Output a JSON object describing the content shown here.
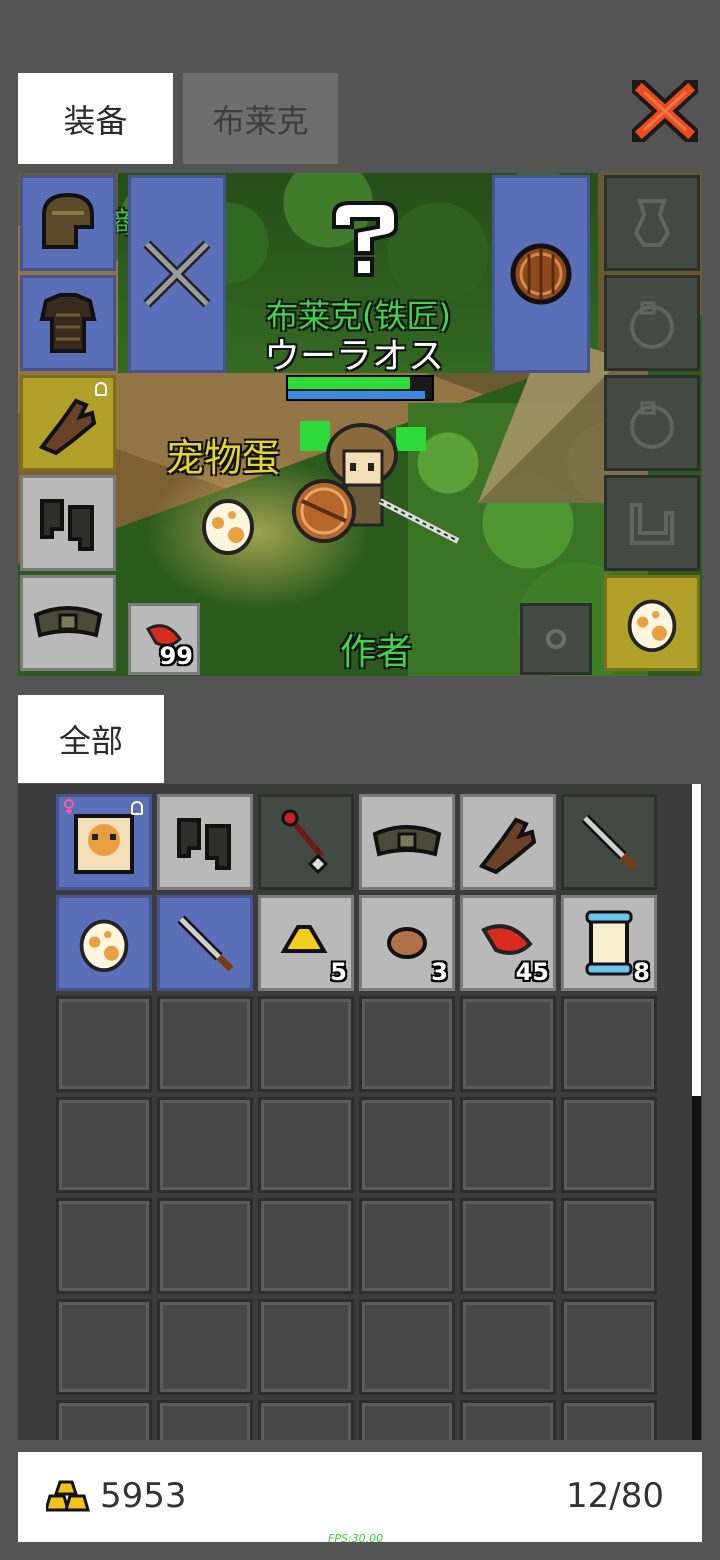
{
  "tabs": {
    "equipment": "装备",
    "character": "布莱克"
  },
  "scene": {
    "npc_name": "布莱克(铁匠)",
    "player_name": "ウーラオス",
    "pet_egg_label": "宠物蛋",
    "author_label": "作者",
    "partial_label": "商",
    "quick_item_count": "99",
    "hp_fraction": 0.85,
    "mp_fraction": 0.95
  },
  "equip_left": [
    {
      "icon": "helmet-icon",
      "style": "blue"
    },
    {
      "icon": "armor-icon",
      "style": "blue"
    },
    {
      "icon": "glove-icon",
      "style": "gold",
      "locked": true
    },
    {
      "icon": "boots-icon",
      "style": "grey"
    },
    {
      "icon": "belt-icon",
      "style": "grey"
    }
  ],
  "equip_right": [
    {
      "icon": "vase-icon",
      "style": "dark"
    },
    {
      "icon": "ring-icon",
      "style": "dark"
    },
    {
      "icon": "ring-icon",
      "style": "dark"
    },
    {
      "icon": "pet-icon",
      "style": "dark"
    },
    {
      "icon": "egg-icon",
      "style": "gold"
    }
  ],
  "inventory_filter": "全部",
  "inventory": [
    {
      "icon": "pet-portrait-icon",
      "style": "blue",
      "locked": true,
      "female": true
    },
    {
      "icon": "boots-icon",
      "style": "grey"
    },
    {
      "icon": "staff-icon",
      "style": "dark"
    },
    {
      "icon": "belt-icon",
      "style": "grey"
    },
    {
      "icon": "glove-icon",
      "style": "grey"
    },
    {
      "icon": "sword-icon",
      "style": "dark"
    },
    {
      "icon": "egg-icon",
      "style": "blue"
    },
    {
      "icon": "sword-icon",
      "style": "blue"
    },
    {
      "icon": "gold-ore-icon",
      "style": "grey",
      "count": "5"
    },
    {
      "icon": "stone-icon",
      "style": "grey",
      "count": "3"
    },
    {
      "icon": "red-feather-icon",
      "style": "grey",
      "count": "45"
    },
    {
      "icon": "scroll-icon",
      "style": "grey",
      "count": "8"
    }
  ],
  "footer": {
    "gold": "5953",
    "capacity": "12/80"
  },
  "fps": "FPS:30.00",
  "colors": {
    "background": "#545454",
    "blue_slot": "#5a6fb8",
    "gold_slot": "#b1a02a",
    "npc_green": "#41d44b",
    "label_yellow": "#e4d62a"
  }
}
